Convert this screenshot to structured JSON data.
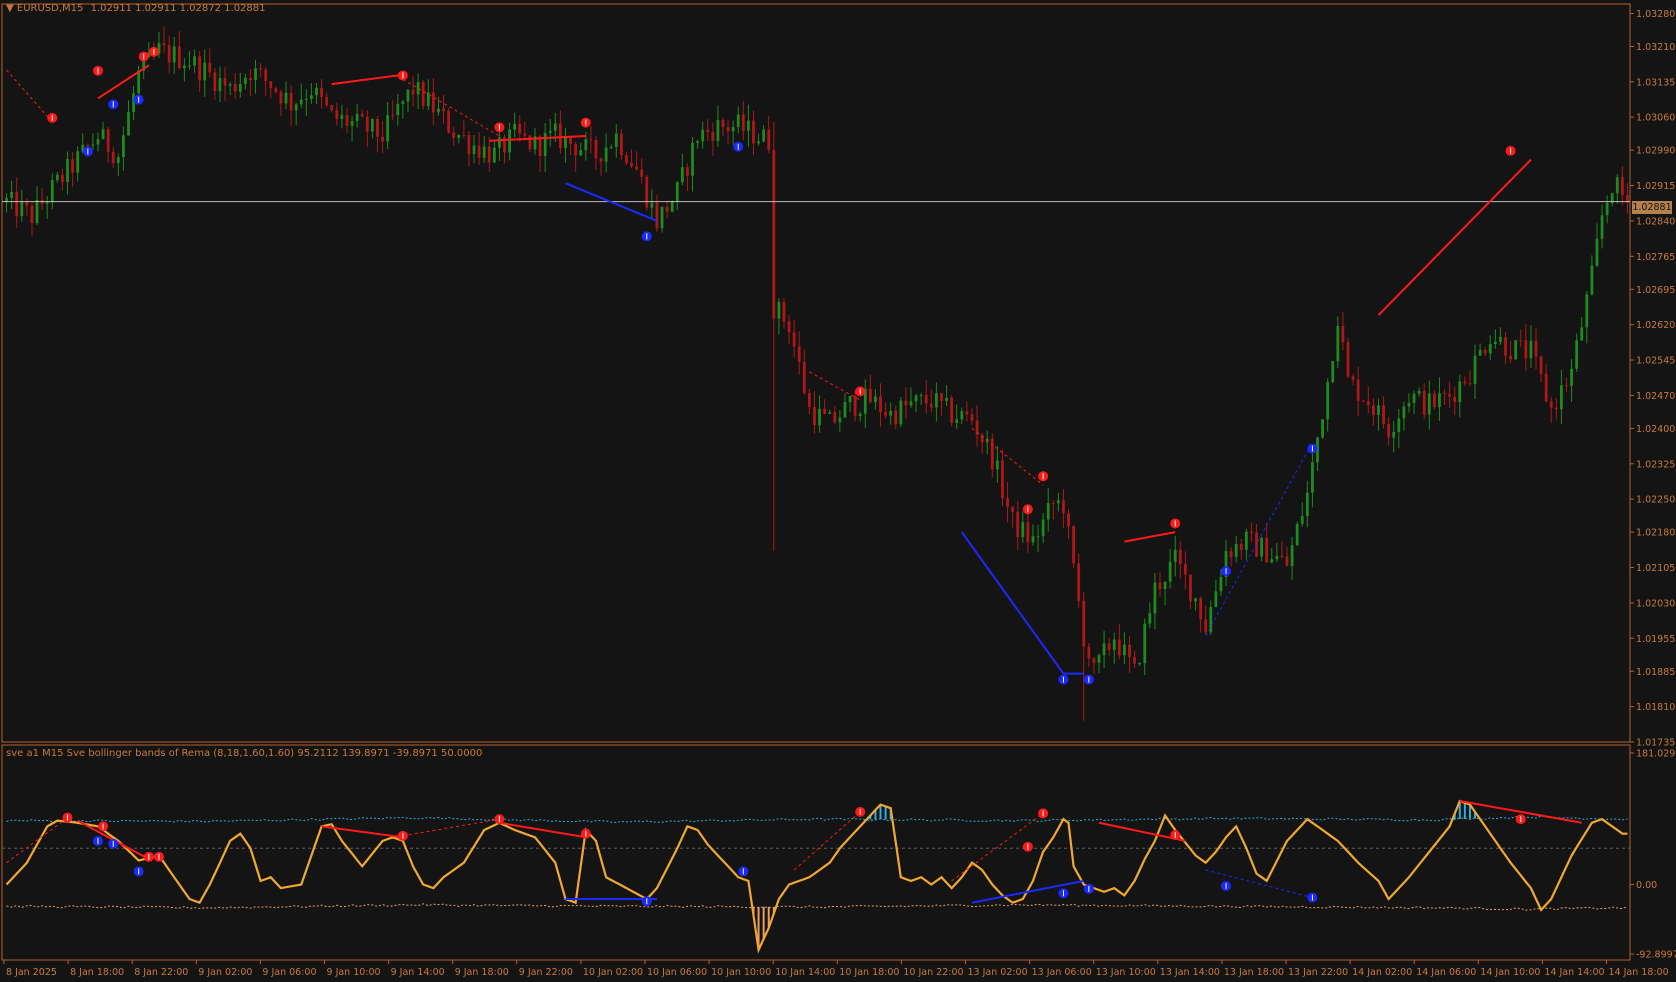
{
  "main": {
    "symbol_label": "EURUSD,M15",
    "ohlc": "1.02911 1.02911 1.02872 1.02881",
    "current_price": "1.02881",
    "price_ticks": [
      "1.03280",
      "1.03210",
      "1.03135",
      "1.03060",
      "1.02990",
      "1.02915",
      "1.02840",
      "1.02765",
      "1.02695",
      "1.02620",
      "1.02545",
      "1.02470",
      "1.02400",
      "1.02325",
      "1.02250",
      "1.02180",
      "1.02105",
      "1.02030",
      "1.01955",
      "1.01885",
      "1.01810",
      "1.01735"
    ]
  },
  "indicator": {
    "label": "sve a1 M15 Sve bollinger bands of Rema (8,18,1.60,1.60) 95.2112 139.8971 -39.8971 50.0000",
    "scale_ticks": [
      "181.0291",
      "0.00",
      "-92.8997"
    ]
  },
  "time_axis": [
    "8 Jan 2025",
    "8 Jan 18:00",
    "8 Jan 22:00",
    "9 Jan 02:00",
    "9 Jan 06:00",
    "9 Jan 10:00",
    "9 Jan 14:00",
    "9 Jan 18:00",
    "9 Jan 22:00",
    "10 Jan 02:00",
    "10 Jan 06:00",
    "10 Jan 10:00",
    "10 Jan 14:00",
    "10 Jan 18:00",
    "10 Jan 22:00",
    "13 Jan 02:00",
    "13 Jan 06:00",
    "13 Jan 10:00",
    "13 Jan 14:00",
    "13 Jan 18:00",
    "13 Jan 22:00",
    "14 Jan 02:00",
    "14 Jan 06:00",
    "14 Jan 10:00",
    "14 Jan 14:00",
    "14 Jan 18:00"
  ],
  "colors": {
    "background": "#141414",
    "frame": "#b4622a",
    "axis_text": "#c87a3c",
    "bull": "#1f8a1f",
    "bear": "#b01818",
    "oscillator": "#f0a830",
    "upper_band": "#2ab0e0",
    "lower_band": "#e8a060",
    "divergence_bear": "#ff1a1a",
    "divergence_bull": "#1a2aff"
  },
  "chart_data": [
    {
      "type": "candlestick",
      "title": "EURUSD,M15",
      "ylim": [
        1.01735,
        1.033
      ],
      "price_path": [
        [
          0,
          1.0288
        ],
        [
          5,
          1.0285
        ],
        [
          10,
          1.0292
        ],
        [
          18,
          1.0302
        ],
        [
          22,
          1.0298
        ],
        [
          26,
          1.0315
        ],
        [
          30,
          1.032
        ],
        [
          36,
          1.0318
        ],
        [
          44,
          1.0312
        ],
        [
          48,
          1.0316
        ],
        [
          52,
          1.0313
        ],
        [
          56,
          1.0309
        ],
        [
          60,
          1.0312
        ],
        [
          64,
          1.0306
        ],
        [
          70,
          1.0304
        ],
        [
          74,
          1.0302
        ],
        [
          78,
          1.0309
        ],
        [
          80,
          1.0312
        ],
        [
          84,
          1.0308
        ],
        [
          88,
          1.0303
        ],
        [
          92,
          1.03
        ],
        [
          96,
          1.0298
        ],
        [
          100,
          1.0302
        ],
        [
          104,
          1.03
        ],
        [
          108,
          1.0302
        ],
        [
          112,
          1.03
        ],
        [
          116,
          1.0298
        ],
        [
          120,
          1.0302
        ],
        [
          124,
          1.0295
        ],
        [
          128,
          1.0284
        ],
        [
          132,
          1.029
        ],
        [
          136,
          1.0302
        ],
        [
          140,
          1.0304
        ],
        [
          144,
          1.0304
        ],
        [
          148,
          1.0302
        ],
        [
          150,
          1.0301
        ],
        [
          151,
          1.0266
        ],
        [
          154,
          1.0262
        ],
        [
          158,
          1.0244
        ],
        [
          162,
          1.0241
        ],
        [
          166,
          1.0245
        ],
        [
          170,
          1.0246
        ],
        [
          174,
          1.0243
        ],
        [
          178,
          1.0245
        ],
        [
          182,
          1.0246
        ],
        [
          186,
          1.0243
        ],
        [
          190,
          1.0242
        ],
        [
          194,
          1.0234
        ],
        [
          198,
          1.022
        ],
        [
          202,
          1.0216
        ],
        [
          206,
          1.0224
        ],
        [
          208,
          1.0224
        ],
        [
          210,
          1.021
        ],
        [
          212,
          1.0196
        ],
        [
          214,
          1.0188
        ],
        [
          218,
          1.0196
        ],
        [
          222,
          1.0188
        ],
        [
          226,
          1.0206
        ],
        [
          230,
          1.0212
        ],
        [
          234,
          1.0204
        ],
        [
          236,
          1.0198
        ],
        [
          240,
          1.0214
        ],
        [
          244,
          1.0216
        ],
        [
          248,
          1.0214
        ],
        [
          252,
          1.0211
        ],
        [
          256,
          1.0226
        ],
        [
          260,
          1.025
        ],
        [
          262,
          1.0264
        ],
        [
          264,
          1.025
        ],
        [
          268,
          1.0246
        ],
        [
          272,
          1.024
        ],
        [
          276,
          1.0247
        ],
        [
          280,
          1.0245
        ],
        [
          284,
          1.0247
        ],
        [
          288,
          1.0252
        ],
        [
          292,
          1.026
        ],
        [
          296,
          1.0257
        ],
        [
          300,
          1.0256
        ],
        [
          304,
          1.0244
        ],
        [
          308,
          1.0252
        ],
        [
          312,
          1.0272
        ],
        [
          314,
          1.0285
        ],
        [
          316,
          1.0292
        ],
        [
          319,
          1.0288
        ]
      ],
      "bear_divergence_lines": [
        [
          [
            18,
            1.031
          ],
          [
            28,
            1.0317
          ]
        ],
        [
          [
            64,
            1.0313
          ],
          [
            78,
            1.0315
          ]
        ],
        [
          [
            95,
            1.0301
          ],
          [
            114,
            1.0302
          ]
        ],
        [
          [
            220,
            1.0216
          ],
          [
            230,
            1.0218
          ]
        ],
        [
          [
            270,
            1.0264
          ],
          [
            300,
            1.0297
          ]
        ]
      ],
      "bull_divergence_lines": [
        [
          [
            110,
            1.0292
          ],
          [
            128,
            1.0284
          ]
        ],
        [
          [
            188,
            1.0218
          ],
          [
            208,
            1.0188
          ]
        ],
        [
          [
            208,
            1.0188
          ],
          [
            212,
            1.0188
          ]
        ]
      ],
      "bear_signals": [
        [
          9,
          1.0305
        ],
        [
          18,
          1.0315
        ],
        [
          27,
          1.0318
        ],
        [
          29,
          1.0319
        ],
        [
          78,
          1.0314
        ],
        [
          97,
          1.0303
        ],
        [
          114,
          1.0304
        ],
        [
          168,
          1.0247
        ],
        [
          201,
          1.0222
        ],
        [
          204,
          1.0229
        ],
        [
          230,
          1.0219
        ],
        [
          296,
          1.0298
        ]
      ],
      "bull_signals": [
        [
          16,
          1.03
        ],
        [
          21,
          1.031
        ],
        [
          26,
          1.0311
        ],
        [
          126,
          1.0282
        ],
        [
          144,
          1.0301
        ],
        [
          208,
          1.0188
        ],
        [
          213,
          1.0188
        ],
        [
          240,
          1.0211
        ],
        [
          257,
          1.0237
        ]
      ]
    },
    {
      "type": "line",
      "title": "sve a1 M15 Sve bollinger bands of Rema (8,18,1.60,1.60)",
      "ylim": [
        -92.8997,
        181.0291
      ],
      "osc_path": [
        [
          0,
          0
        ],
        [
          4,
          30
        ],
        [
          8,
          80
        ],
        [
          10,
          88
        ],
        [
          14,
          85
        ],
        [
          18,
          80
        ],
        [
          22,
          60
        ],
        [
          26,
          33
        ],
        [
          30,
          40
        ],
        [
          32,
          20
        ],
        [
          36,
          -20
        ],
        [
          38,
          -25
        ],
        [
          40,
          0
        ],
        [
          44,
          60
        ],
        [
          46,
          70
        ],
        [
          48,
          50
        ],
        [
          50,
          5
        ],
        [
          52,
          10
        ],
        [
          54,
          -5
        ],
        [
          58,
          0
        ],
        [
          62,
          80
        ],
        [
          64,
          83
        ],
        [
          66,
          60
        ],
        [
          70,
          25
        ],
        [
          74,
          60
        ],
        [
          76,
          65
        ],
        [
          78,
          60
        ],
        [
          80,
          25
        ],
        [
          82,
          0
        ],
        [
          84,
          -5
        ],
        [
          86,
          10
        ],
        [
          90,
          30
        ],
        [
          94,
          75
        ],
        [
          97,
          85
        ],
        [
          100,
          75
        ],
        [
          104,
          65
        ],
        [
          108,
          30
        ],
        [
          110,
          -20
        ],
        [
          112,
          -25
        ],
        [
          114,
          75
        ],
        [
          116,
          60
        ],
        [
          118,
          10
        ],
        [
          122,
          -5
        ],
        [
          126,
          -20
        ],
        [
          128,
          -5
        ],
        [
          132,
          50
        ],
        [
          134,
          80
        ],
        [
          136,
          75
        ],
        [
          138,
          55
        ],
        [
          140,
          40
        ],
        [
          144,
          10
        ],
        [
          146,
          5
        ],
        [
          148,
          -90
        ],
        [
          150,
          -60
        ],
        [
          152,
          -20
        ],
        [
          154,
          0
        ],
        [
          158,
          10
        ],
        [
          162,
          30
        ],
        [
          164,
          50
        ],
        [
          168,
          80
        ],
        [
          170,
          95
        ],
        [
          172,
          110
        ],
        [
          174,
          105
        ],
        [
          176,
          10
        ],
        [
          178,
          5
        ],
        [
          180,
          10
        ],
        [
          182,
          0
        ],
        [
          184,
          10
        ],
        [
          186,
          -5
        ],
        [
          188,
          10
        ],
        [
          190,
          30
        ],
        [
          192,
          20
        ],
        [
          194,
          0
        ],
        [
          196,
          -15
        ],
        [
          198,
          -25
        ],
        [
          200,
          -20
        ],
        [
          202,
          5
        ],
        [
          204,
          45
        ],
        [
          206,
          65
        ],
        [
          208,
          90
        ],
        [
          209,
          85
        ],
        [
          210,
          25
        ],
        [
          212,
          0
        ],
        [
          214,
          -5
        ],
        [
          216,
          -10
        ],
        [
          218,
          -5
        ],
        [
          220,
          -15
        ],
        [
          222,
          5
        ],
        [
          224,
          35
        ],
        [
          226,
          60
        ],
        [
          228,
          95
        ],
        [
          230,
          75
        ],
        [
          234,
          40
        ],
        [
          236,
          30
        ],
        [
          238,
          45
        ],
        [
          240,
          65
        ],
        [
          242,
          80
        ],
        [
          244,
          50
        ],
        [
          246,
          15
        ],
        [
          248,
          5
        ],
        [
          252,
          60
        ],
        [
          256,
          90
        ],
        [
          260,
          70
        ],
        [
          262,
          60
        ],
        [
          266,
          30
        ],
        [
          270,
          5
        ],
        [
          272,
          -20
        ],
        [
          276,
          10
        ],
        [
          280,
          45
        ],
        [
          284,
          80
        ],
        [
          286,
          115
        ],
        [
          288,
          110
        ],
        [
          290,
          90
        ],
        [
          292,
          70
        ],
        [
          296,
          30
        ],
        [
          300,
          -5
        ],
        [
          302,
          -35
        ],
        [
          304,
          -20
        ],
        [
          308,
          40
        ],
        [
          312,
          85
        ],
        [
          314,
          90
        ],
        [
          318,
          70
        ]
      ],
      "upper_band": [
        [
          0,
          88
        ],
        [
          40,
          87
        ],
        [
          80,
          92
        ],
        [
          120,
          86
        ],
        [
          160,
          90
        ],
        [
          200,
          88
        ],
        [
          240,
          91
        ],
        [
          280,
          89
        ],
        [
          300,
          93
        ],
        [
          318,
          90
        ]
      ],
      "lower_band": [
        [
          0,
          -30
        ],
        [
          40,
          -32
        ],
        [
          80,
          -28
        ],
        [
          120,
          -30
        ],
        [
          160,
          -31
        ],
        [
          200,
          -28
        ],
        [
          240,
          -30
        ],
        [
          280,
          -32
        ],
        [
          300,
          -34
        ],
        [
          318,
          -32
        ]
      ],
      "bear_divergence_lines": [
        [
          [
            14,
            88
          ],
          [
            28,
            35
          ]
        ],
        [
          [
            62,
            80
          ],
          [
            78,
            65
          ]
        ],
        [
          [
            97,
            85
          ],
          [
            114,
            65
          ]
        ],
        [
          [
            215,
            85
          ],
          [
            232,
            60
          ]
        ],
        [
          [
            286,
            115
          ],
          [
            310,
            85
          ]
        ]
      ],
      "bull_divergence_lines": [
        [
          [
            110,
            -20
          ],
          [
            128,
            -20
          ]
        ],
        [
          [
            190,
            -25
          ],
          [
            212,
            5
          ]
        ]
      ],
      "bear_signals": [
        [
          12,
          92
        ],
        [
          19,
          80
        ],
        [
          28,
          38
        ],
        [
          30,
          38
        ],
        [
          78,
          67
        ],
        [
          97,
          90
        ],
        [
          114,
          70
        ],
        [
          168,
          100
        ],
        [
          201,
          52
        ],
        [
          204,
          98
        ],
        [
          230,
          68
        ],
        [
          298,
          90
        ]
      ],
      "bull_signals": [
        [
          18,
          60
        ],
        [
          21,
          56
        ],
        [
          26,
          18
        ],
        [
          145,
          18
        ],
        [
          126,
          -23
        ],
        [
          208,
          -12
        ],
        [
          213,
          -6
        ],
        [
          240,
          -2
        ],
        [
          257,
          -18
        ]
      ]
    }
  ]
}
